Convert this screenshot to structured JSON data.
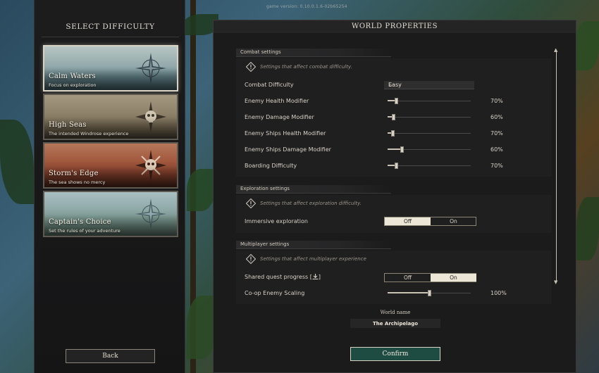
{
  "game_version": "game version: 0.10.0.1.6-02b65254",
  "left_panel": {
    "title": "SELECT DIFFICULTY",
    "cards": [
      {
        "title": "Calm Waters",
        "subtitle": "Focus on exploration",
        "selected": true,
        "emblem": "compass-rose-icon"
      },
      {
        "title": "High Seas",
        "subtitle": "The intended Windrose experience",
        "selected": false,
        "emblem": "skull-compass-icon"
      },
      {
        "title": "Storm's Edge",
        "subtitle": "The sea shows no mercy",
        "selected": false,
        "emblem": "skull-crossbones-compass-icon"
      },
      {
        "title": "Captain's Choice",
        "subtitle": "Set the rules of your adventure",
        "selected": false,
        "emblem": "compass-rose-icon"
      }
    ],
    "back_label": "Back"
  },
  "right_panel": {
    "title": "WORLD PROPERTIES",
    "combat": {
      "section_title": "Combat settings",
      "note": "Settings that affect combat difficulty.",
      "combat_difficulty": {
        "label": "Combat Difficulty",
        "value": "Easy"
      },
      "sliders": [
        {
          "label": "Enemy Health Modifier",
          "value": "70%",
          "fraction": 0.1
        },
        {
          "label": "Enemy Damage Modifier",
          "value": "60%",
          "fraction": 0.07
        },
        {
          "label": "Enemy Ships Health Modifier",
          "value": "70%",
          "fraction": 0.06
        },
        {
          "label": "Enemy Ships Damage Modifier",
          "value": "60%",
          "fraction": 0.17
        },
        {
          "label": "Boarding Difficulty",
          "value": "70%",
          "fraction": 0.1
        }
      ]
    },
    "exploration": {
      "section_title": "Exploration settings",
      "note": "Settings that affect exploration difficulty.",
      "immersive": {
        "label": "Immersive exploration",
        "off_label": "Off",
        "on_label": "On",
        "selected": "Off"
      }
    },
    "multiplayer": {
      "section_title": "Multiplayer settings",
      "note": "Settings that affect multiplayer experience",
      "shared_quest": {
        "label": "Shared quest progress [",
        "label_suffix": "]",
        "off_label": "Off",
        "on_label": "On",
        "selected": "On"
      },
      "coop_scaling": {
        "label": "Co-op Enemy Scaling",
        "value": "100%",
        "fraction": 0.5
      }
    },
    "world_name_label": "World name",
    "world_name_value": "The Archipelago",
    "confirm_label": "Confirm"
  },
  "colors": {
    "accent_green": "#1e4c42",
    "panel_bg": "#1b1b1c",
    "selected_border": "#d9d3c4"
  }
}
